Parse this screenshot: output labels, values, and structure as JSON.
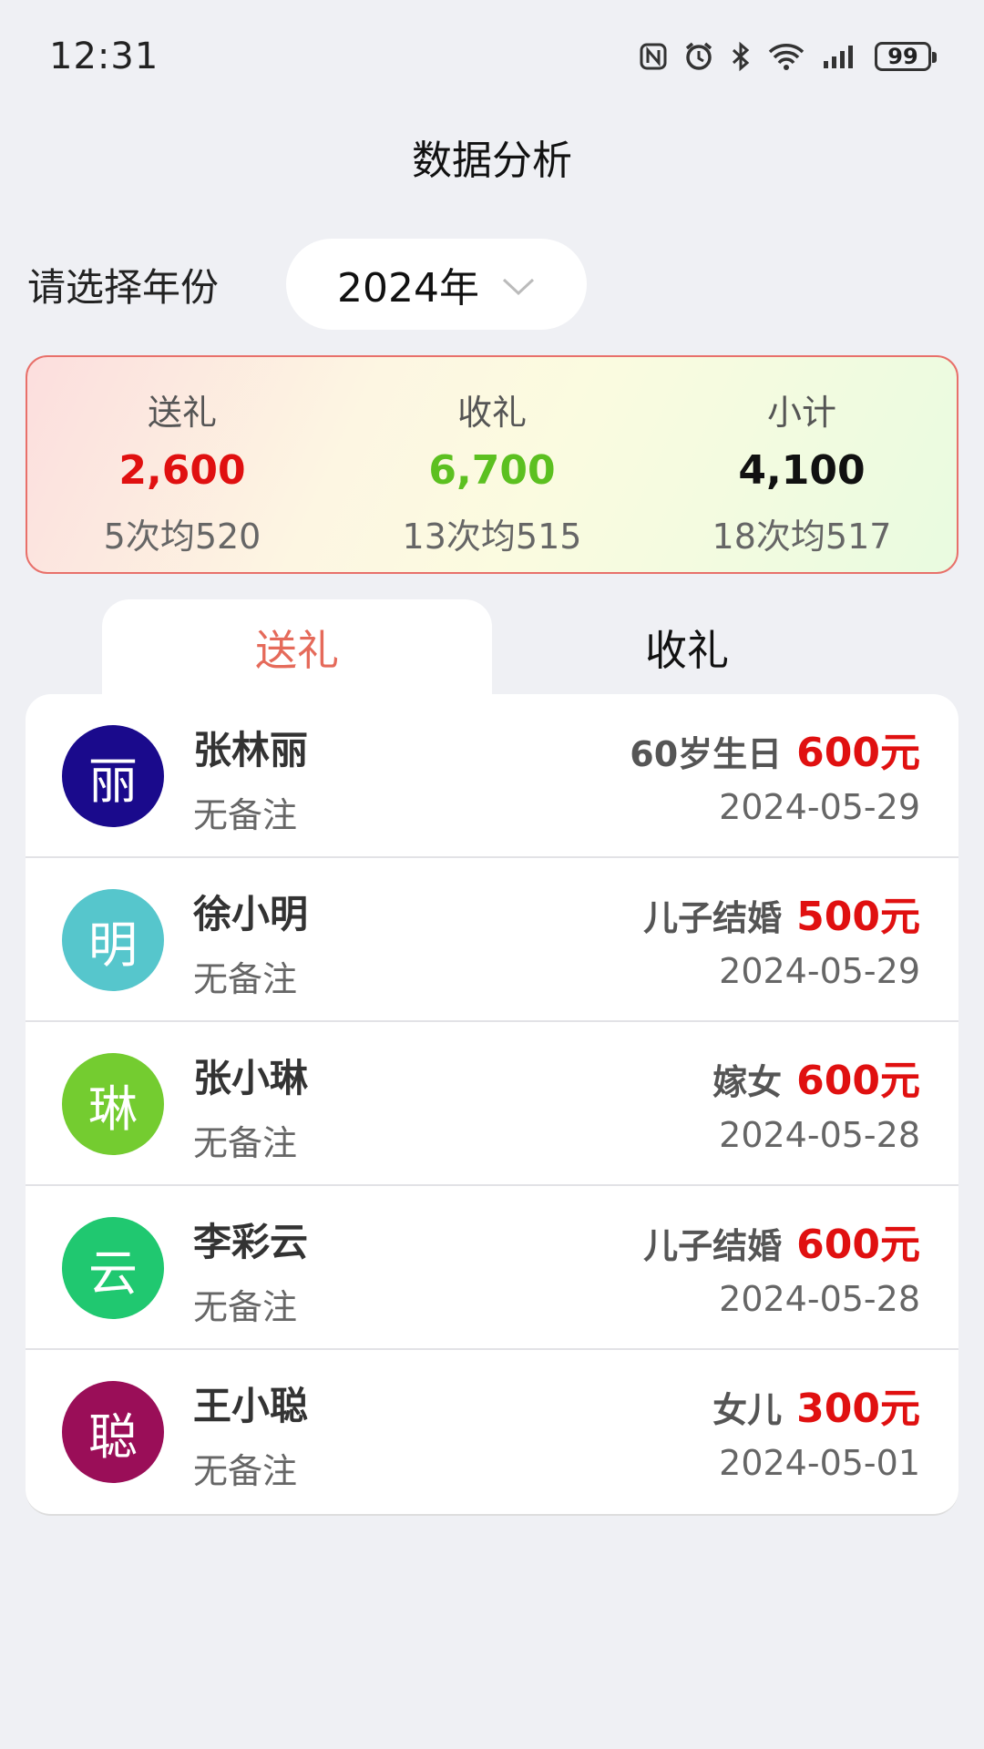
{
  "status_bar": {
    "time": "12:31",
    "battery": "99",
    "icons": [
      "nfc-icon",
      "alarm-icon",
      "bluetooth-icon",
      "wifi-icon",
      "signal-icon",
      "battery-icon"
    ]
  },
  "page_title": "数据分析",
  "year_selector": {
    "label": "请选择年份",
    "value": "2024年"
  },
  "summary": {
    "give": {
      "title": "送礼",
      "value": "2,600",
      "sub": "5次均520",
      "color": "#e01010"
    },
    "receive": {
      "title": "收礼",
      "value": "6,700",
      "sub": "13次均515",
      "color": "#5cc020"
    },
    "subtotal": {
      "title": "小计",
      "value": "4,100",
      "sub": "18次均517",
      "color": "#111111"
    }
  },
  "tabs": [
    {
      "label": "送礼",
      "active": true
    },
    {
      "label": "收礼",
      "active": false
    }
  ],
  "records": [
    {
      "avatar_char": "丽",
      "avatar_color": "#1a0a8c",
      "name": "张林丽",
      "note": "无备注",
      "reason": "60岁生日",
      "amount": "600元",
      "date": "2024-05-29"
    },
    {
      "avatar_char": "明",
      "avatar_color": "#56c6cc",
      "name": "徐小明",
      "note": "无备注",
      "reason": "儿子结婚",
      "amount": "500元",
      "date": "2024-05-29"
    },
    {
      "avatar_char": "琳",
      "avatar_color": "#74cc30",
      "name": "张小琳",
      "note": "无备注",
      "reason": "嫁女",
      "amount": "600元",
      "date": "2024-05-28"
    },
    {
      "avatar_char": "云",
      "avatar_color": "#20c870",
      "name": "李彩云",
      "note": "无备注",
      "reason": "儿子结婚",
      "amount": "600元",
      "date": "2024-05-28"
    },
    {
      "avatar_char": "聪",
      "avatar_color": "#9a0e58",
      "name": "王小聪",
      "note": "无备注",
      "reason": "女儿",
      "amount": "300元",
      "date": "2024-05-01"
    }
  ]
}
